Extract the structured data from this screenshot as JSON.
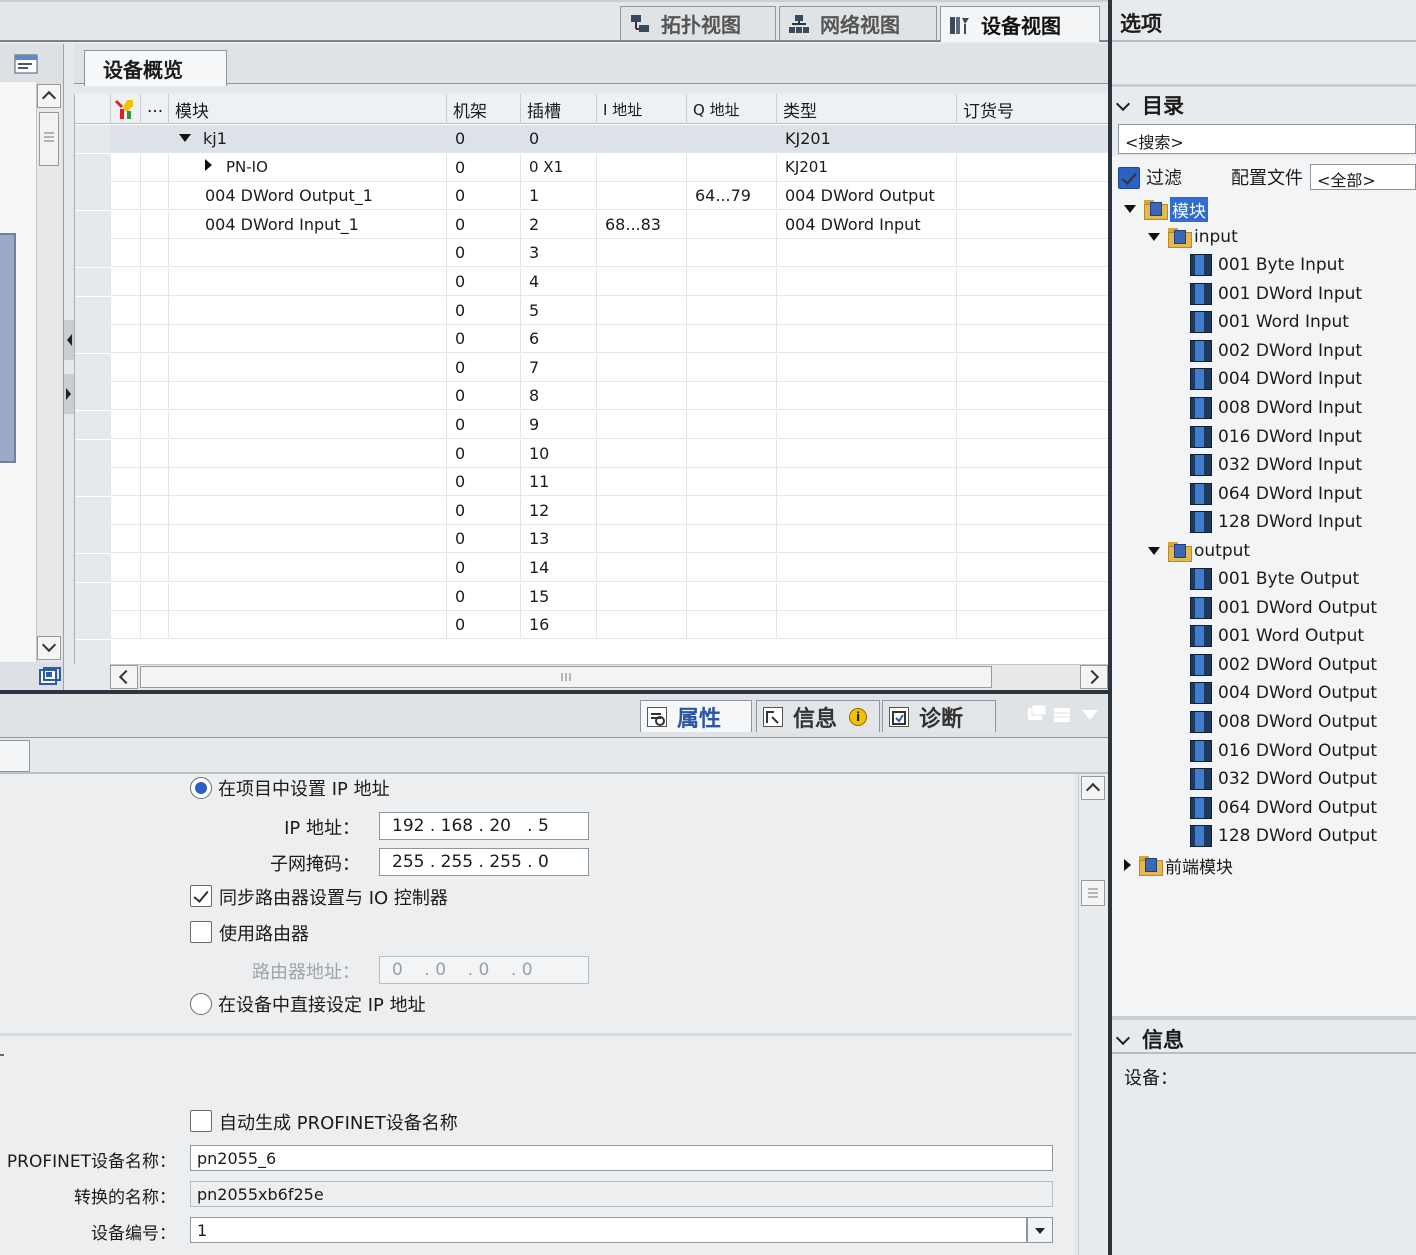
{
  "view_tabs": [
    {
      "label": "拓扑视图",
      "icon": "topology-icon"
    },
    {
      "label": "网络视图",
      "icon": "network-icon"
    },
    {
      "label": "设备视图",
      "icon": "device-icon",
      "active": true
    }
  ],
  "overview_tab": "设备概览",
  "table": {
    "columns": [
      "...",
      "模块",
      "机架",
      "插槽",
      "I 地址",
      "Q 地址",
      "类型",
      "订货号"
    ],
    "rows": [
      {
        "module": "kj1",
        "rack": "0",
        "slot": "0",
        "i_addr": "",
        "q_addr": "",
        "type": "KJ201"
      },
      {
        "module": "PN-IO",
        "rack": "0",
        "slot": "0 X1",
        "i_addr": "",
        "q_addr": "",
        "type": "KJ201"
      },
      {
        "module": "004 DWord Output_1",
        "rack": "0",
        "slot": "1",
        "i_addr": "",
        "q_addr": "64...79",
        "type": "004 DWord Output"
      },
      {
        "module": "004 DWord Input_1",
        "rack": "0",
        "slot": "2",
        "i_addr": "68...83",
        "q_addr": "",
        "type": "004 DWord Input"
      },
      {
        "module": "",
        "rack": "0",
        "slot": "3",
        "i_addr": "",
        "q_addr": "",
        "type": ""
      },
      {
        "module": "",
        "rack": "0",
        "slot": "4",
        "i_addr": "",
        "q_addr": "",
        "type": ""
      },
      {
        "module": "",
        "rack": "0",
        "slot": "5",
        "i_addr": "",
        "q_addr": "",
        "type": ""
      },
      {
        "module": "",
        "rack": "0",
        "slot": "6",
        "i_addr": "",
        "q_addr": "",
        "type": ""
      },
      {
        "module": "",
        "rack": "0",
        "slot": "7",
        "i_addr": "",
        "q_addr": "",
        "type": ""
      },
      {
        "module": "",
        "rack": "0",
        "slot": "8",
        "i_addr": "",
        "q_addr": "",
        "type": ""
      },
      {
        "module": "",
        "rack": "0",
        "slot": "9",
        "i_addr": "",
        "q_addr": "",
        "type": ""
      },
      {
        "module": "",
        "rack": "0",
        "slot": "10",
        "i_addr": "",
        "q_addr": "",
        "type": ""
      },
      {
        "module": "",
        "rack": "0",
        "slot": "11",
        "i_addr": "",
        "q_addr": "",
        "type": ""
      },
      {
        "module": "",
        "rack": "0",
        "slot": "12",
        "i_addr": "",
        "q_addr": "",
        "type": ""
      },
      {
        "module": "",
        "rack": "0",
        "slot": "13",
        "i_addr": "",
        "q_addr": "",
        "type": ""
      },
      {
        "module": "",
        "rack": "0",
        "slot": "14",
        "i_addr": "",
        "q_addr": "",
        "type": ""
      },
      {
        "module": "",
        "rack": "0",
        "slot": "15",
        "i_addr": "",
        "q_addr": "",
        "type": ""
      },
      {
        "module": "",
        "rack": "0",
        "slot": "16",
        "i_addr": "",
        "q_addr": "",
        "type": ""
      }
    ]
  },
  "inspector_tabs": [
    {
      "label": "属性",
      "active": true
    },
    {
      "label": "信息"
    },
    {
      "label": "诊断"
    }
  ],
  "properties": {
    "radio_project_ip": "在项目中设置 IP 地址",
    "ip_label": "IP 地址：",
    "ip_value": "192 . 168 . 20   . 5",
    "mask_label": "子网掩码：",
    "mask_value": "255 . 255 . 255 . 0",
    "sync_router": "同步路由器设置与 IO 控制器",
    "use_router": "使用路由器",
    "router_label": "路由器地址：",
    "router_value": "0    . 0    . 0    . 0",
    "radio_device_ip": "在设备中直接设定 IP 地址",
    "auto_name": "自动生成 PROFINET设备名称",
    "profinet_label": "PROFINET设备名称：",
    "profinet_value": "pn2055_6",
    "converted_label": "转换的名称：",
    "converted_value": "pn2055xb6f25e",
    "devnum_label": "设备编号：",
    "devnum_value": "1"
  },
  "right": {
    "options_title": "选项",
    "catalog_title": "目录",
    "search_placeholder": "<搜索>",
    "filter_label": "过滤",
    "profile_label": "配置文件",
    "profile_value": "<全部>",
    "root": "模块",
    "input_folder": "input",
    "inputs": [
      "001 Byte Input",
      "001 DWord Input",
      "001 Word Input",
      "002 DWord Input",
      "004 DWord Input",
      "008 DWord Input",
      "016 DWord Input",
      "032 DWord Input",
      "064 DWord Input",
      "128 DWord Input"
    ],
    "output_folder": "output",
    "outputs": [
      "001 Byte Output",
      "001 DWord Output",
      "001 Word Output",
      "002 DWord Output",
      "004 DWord Output",
      "008 DWord Output",
      "016 DWord Output",
      "032 DWord Output",
      "064 DWord Output",
      "128 DWord Output"
    ],
    "frontend": "前端模块",
    "info_title": "信息",
    "device_label": "设备："
  }
}
